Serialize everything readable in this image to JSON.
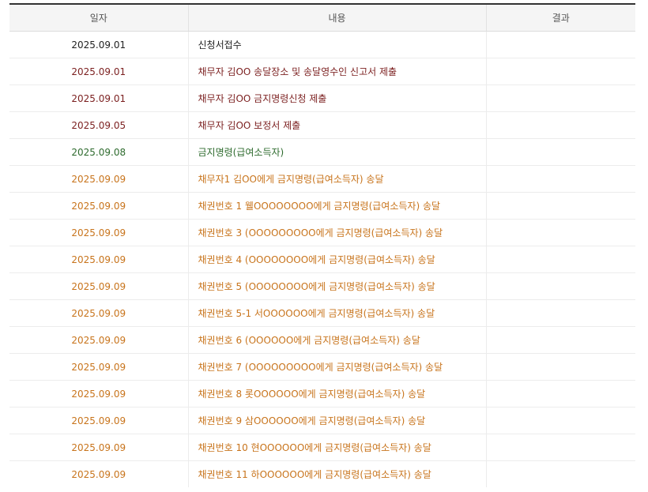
{
  "colors": {
    "black": "#222222",
    "maroon": "#7b1f1f",
    "green": "#2e6b2e",
    "orange": "#c8741c"
  },
  "table": {
    "headers": [
      "일자",
      "내용",
      "결과"
    ],
    "rows": [
      {
        "date": "2025.09.01",
        "content": "신청서접수",
        "result": "",
        "color": "black"
      },
      {
        "date": "2025.09.01",
        "content": "채무자 김OO 송달장소 및 송달영수인 신고서 제출",
        "result": "",
        "color": "maroon"
      },
      {
        "date": "2025.09.01",
        "content": "채무자 김OO 금지명령신청 제출",
        "result": "",
        "color": "maroon"
      },
      {
        "date": "2025.09.05",
        "content": "채무자 김OO 보정서 제출",
        "result": "",
        "color": "maroon"
      },
      {
        "date": "2025.09.08",
        "content": "금지명령(급여소득자)",
        "result": "",
        "color": "green"
      },
      {
        "date": "2025.09.09",
        "content": "채무자1 김OO에게 금지명령(급여소득자) 송달",
        "result": "",
        "color": "orange"
      },
      {
        "date": "2025.09.09",
        "content": "채권번호 1 웰OOOOOOOO에게 금지명령(급여소득자) 송달",
        "result": "",
        "color": "orange"
      },
      {
        "date": "2025.09.09",
        "content": "채권번호 3 (OOOOOOOOO에게 금지명령(급여소득자) 송달",
        "result": "",
        "color": "orange"
      },
      {
        "date": "2025.09.09",
        "content": "채권번호 4 (OOOOOOOO에게 금지명령(급여소득자) 송달",
        "result": "",
        "color": "orange"
      },
      {
        "date": "2025.09.09",
        "content": "채권번호 5 (OOOOOOOO에게 금지명령(급여소득자) 송달",
        "result": "",
        "color": "orange"
      },
      {
        "date": "2025.09.09",
        "content": "채권번호 5-1 서OOOOOO에게 금지명령(급여소득자) 송달",
        "result": "",
        "color": "orange"
      },
      {
        "date": "2025.09.09",
        "content": "채권번호 6 (OOOOOO에게 금지명령(급여소득자) 송달",
        "result": "",
        "color": "orange"
      },
      {
        "date": "2025.09.09",
        "content": "채권번호 7 (OOOOOOOOO에게 금지명령(급여소득자) 송달",
        "result": "",
        "color": "orange"
      },
      {
        "date": "2025.09.09",
        "content": "채권번호 8 롯OOOOOO에게 금지명령(급여소득자) 송달",
        "result": "",
        "color": "orange"
      },
      {
        "date": "2025.09.09",
        "content": "채권번호 9 삼OOOOOO에게 금지명령(급여소득자) 송달",
        "result": "",
        "color": "orange"
      },
      {
        "date": "2025.09.09",
        "content": "채권번호 10 현OOOOOO에게 금지명령(급여소득자) 송달",
        "result": "",
        "color": "orange"
      },
      {
        "date": "2025.09.09",
        "content": "채권번호 11 하OOOOOO에게 금지명령(급여소득자) 송달",
        "result": "",
        "color": "orange"
      }
    ]
  }
}
